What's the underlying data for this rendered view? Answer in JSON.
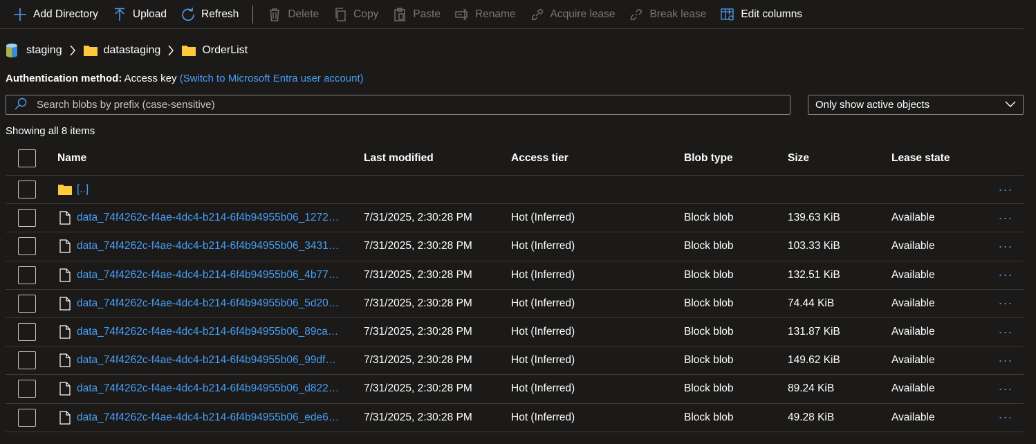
{
  "toolbar": {
    "add_directory": "Add Directory",
    "upload": "Upload",
    "refresh": "Refresh",
    "delete": "Delete",
    "copy": "Copy",
    "paste": "Paste",
    "rename": "Rename",
    "acquire_lease": "Acquire lease",
    "break_lease": "Break lease",
    "edit_columns": "Edit columns"
  },
  "breadcrumb": {
    "container": "staging",
    "folder1": "datastaging",
    "folder2": "OrderList"
  },
  "auth": {
    "label": "Authentication method:",
    "value": "Access key",
    "switch_link": "(Switch to Microsoft Entra user account)"
  },
  "search": {
    "placeholder": "Search blobs by prefix (case-sensitive)"
  },
  "filter": {
    "selected": "Only show active objects"
  },
  "count_text": "Showing all 8 items",
  "columns": {
    "name": "Name",
    "last_modified": "Last modified",
    "access_tier": "Access tier",
    "blob_type": "Blob type",
    "size": "Size",
    "lease_state": "Lease state"
  },
  "parent_row": {
    "name": "[..]"
  },
  "more_glyph": "···",
  "rows": [
    {
      "name": "data_74f4262c-f4ae-4dc4-b214-6f4b94955b06_1272…",
      "modified": "7/31/2025, 2:30:28 PM",
      "tier": "Hot (Inferred)",
      "type": "Block blob",
      "size": "139.63 KiB",
      "lease": "Available"
    },
    {
      "name": "data_74f4262c-f4ae-4dc4-b214-6f4b94955b06_3431…",
      "modified": "7/31/2025, 2:30:28 PM",
      "tier": "Hot (Inferred)",
      "type": "Block blob",
      "size": "103.33 KiB",
      "lease": "Available"
    },
    {
      "name": "data_74f4262c-f4ae-4dc4-b214-6f4b94955b06_4b77…",
      "modified": "7/31/2025, 2:30:28 PM",
      "tier": "Hot (Inferred)",
      "type": "Block blob",
      "size": "132.51 KiB",
      "lease": "Available"
    },
    {
      "name": "data_74f4262c-f4ae-4dc4-b214-6f4b94955b06_5d20…",
      "modified": "7/31/2025, 2:30:28 PM",
      "tier": "Hot (Inferred)",
      "type": "Block blob",
      "size": "74.44 KiB",
      "lease": "Available"
    },
    {
      "name": "data_74f4262c-f4ae-4dc4-b214-6f4b94955b06_89ca…",
      "modified": "7/31/2025, 2:30:28 PM",
      "tier": "Hot (Inferred)",
      "type": "Block blob",
      "size": "131.87 KiB",
      "lease": "Available"
    },
    {
      "name": "data_74f4262c-f4ae-4dc4-b214-6f4b94955b06_99df…",
      "modified": "7/31/2025, 2:30:28 PM",
      "tier": "Hot (Inferred)",
      "type": "Block blob",
      "size": "149.62 KiB",
      "lease": "Available"
    },
    {
      "name": "data_74f4262c-f4ae-4dc4-b214-6f4b94955b06_d822…",
      "modified": "7/31/2025, 2:30:28 PM",
      "tier": "Hot (Inferred)",
      "type": "Block blob",
      "size": "89.24 KiB",
      "lease": "Available"
    },
    {
      "name": "data_74f4262c-f4ae-4dc4-b214-6f4b94955b06_ede6…",
      "modified": "7/31/2025, 2:30:28 PM",
      "tier": "Hot (Inferred)",
      "type": "Block blob",
      "size": "49.28 KiB",
      "lease": "Available"
    }
  ],
  "colors": {
    "background": "#1b1a19",
    "link": "#479ef5",
    "accent": "#4f9ef0",
    "folder": "#ffc83d",
    "disabled": "#7a7876"
  }
}
